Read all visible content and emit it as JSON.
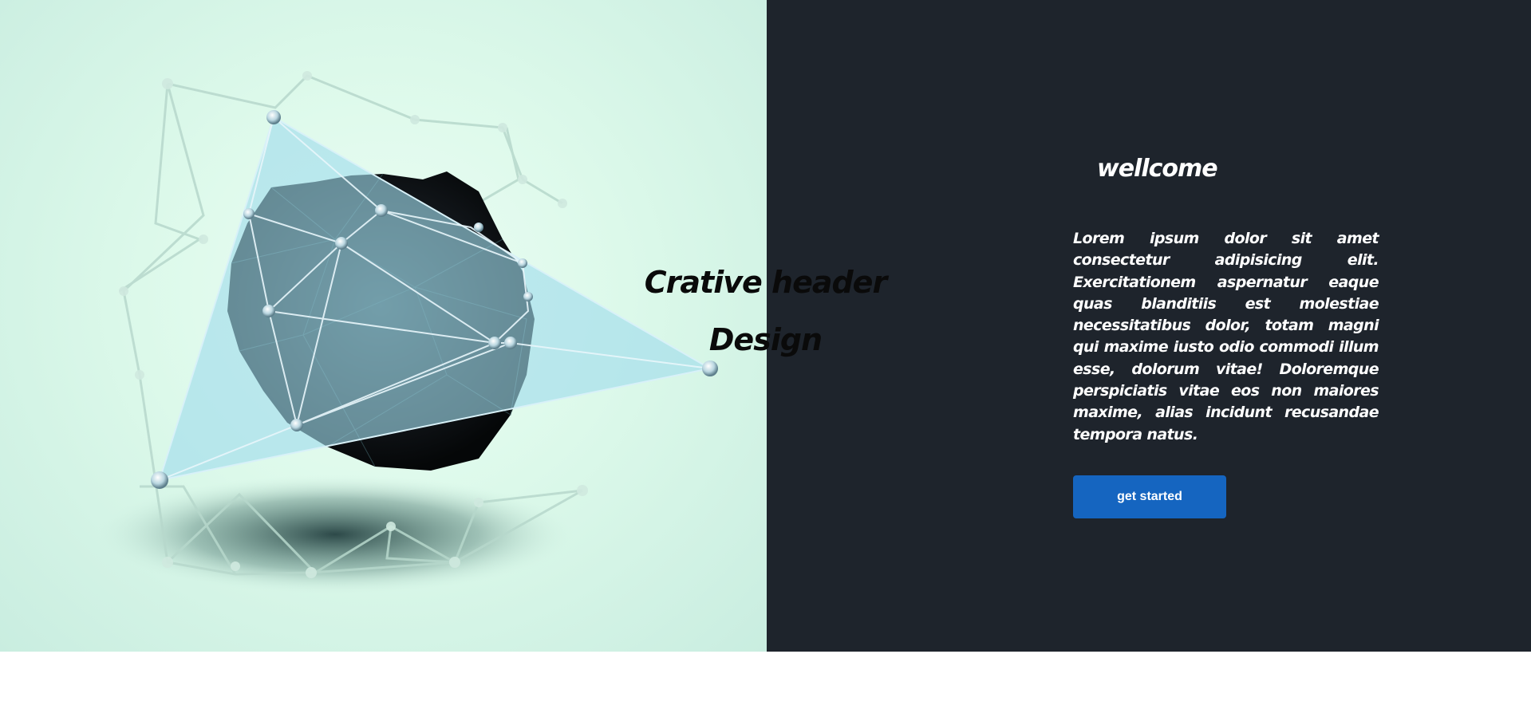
{
  "hero": {
    "title_line1": "Crative header",
    "title_line2": "Design"
  },
  "intro": {
    "heading": "wellcome",
    "body": "Lorem ipsum dolor sit amet consectetur adipisicing elit. Exercitationem aspernatur eaque quas blanditiis est molestiae necessitatibus dolor, totam magni qui maxime iusto odio commodi illum esse, dolorum vitae! Doloremque perspiciatis vitae eos non maiores maxime, alias incidunt recusandae tempora natus.",
    "cta_label": "get started"
  },
  "colors": {
    "dark_panel": "#1e242c",
    "accent_button": "#1565c0",
    "mint_background": "#dcf9ea"
  }
}
